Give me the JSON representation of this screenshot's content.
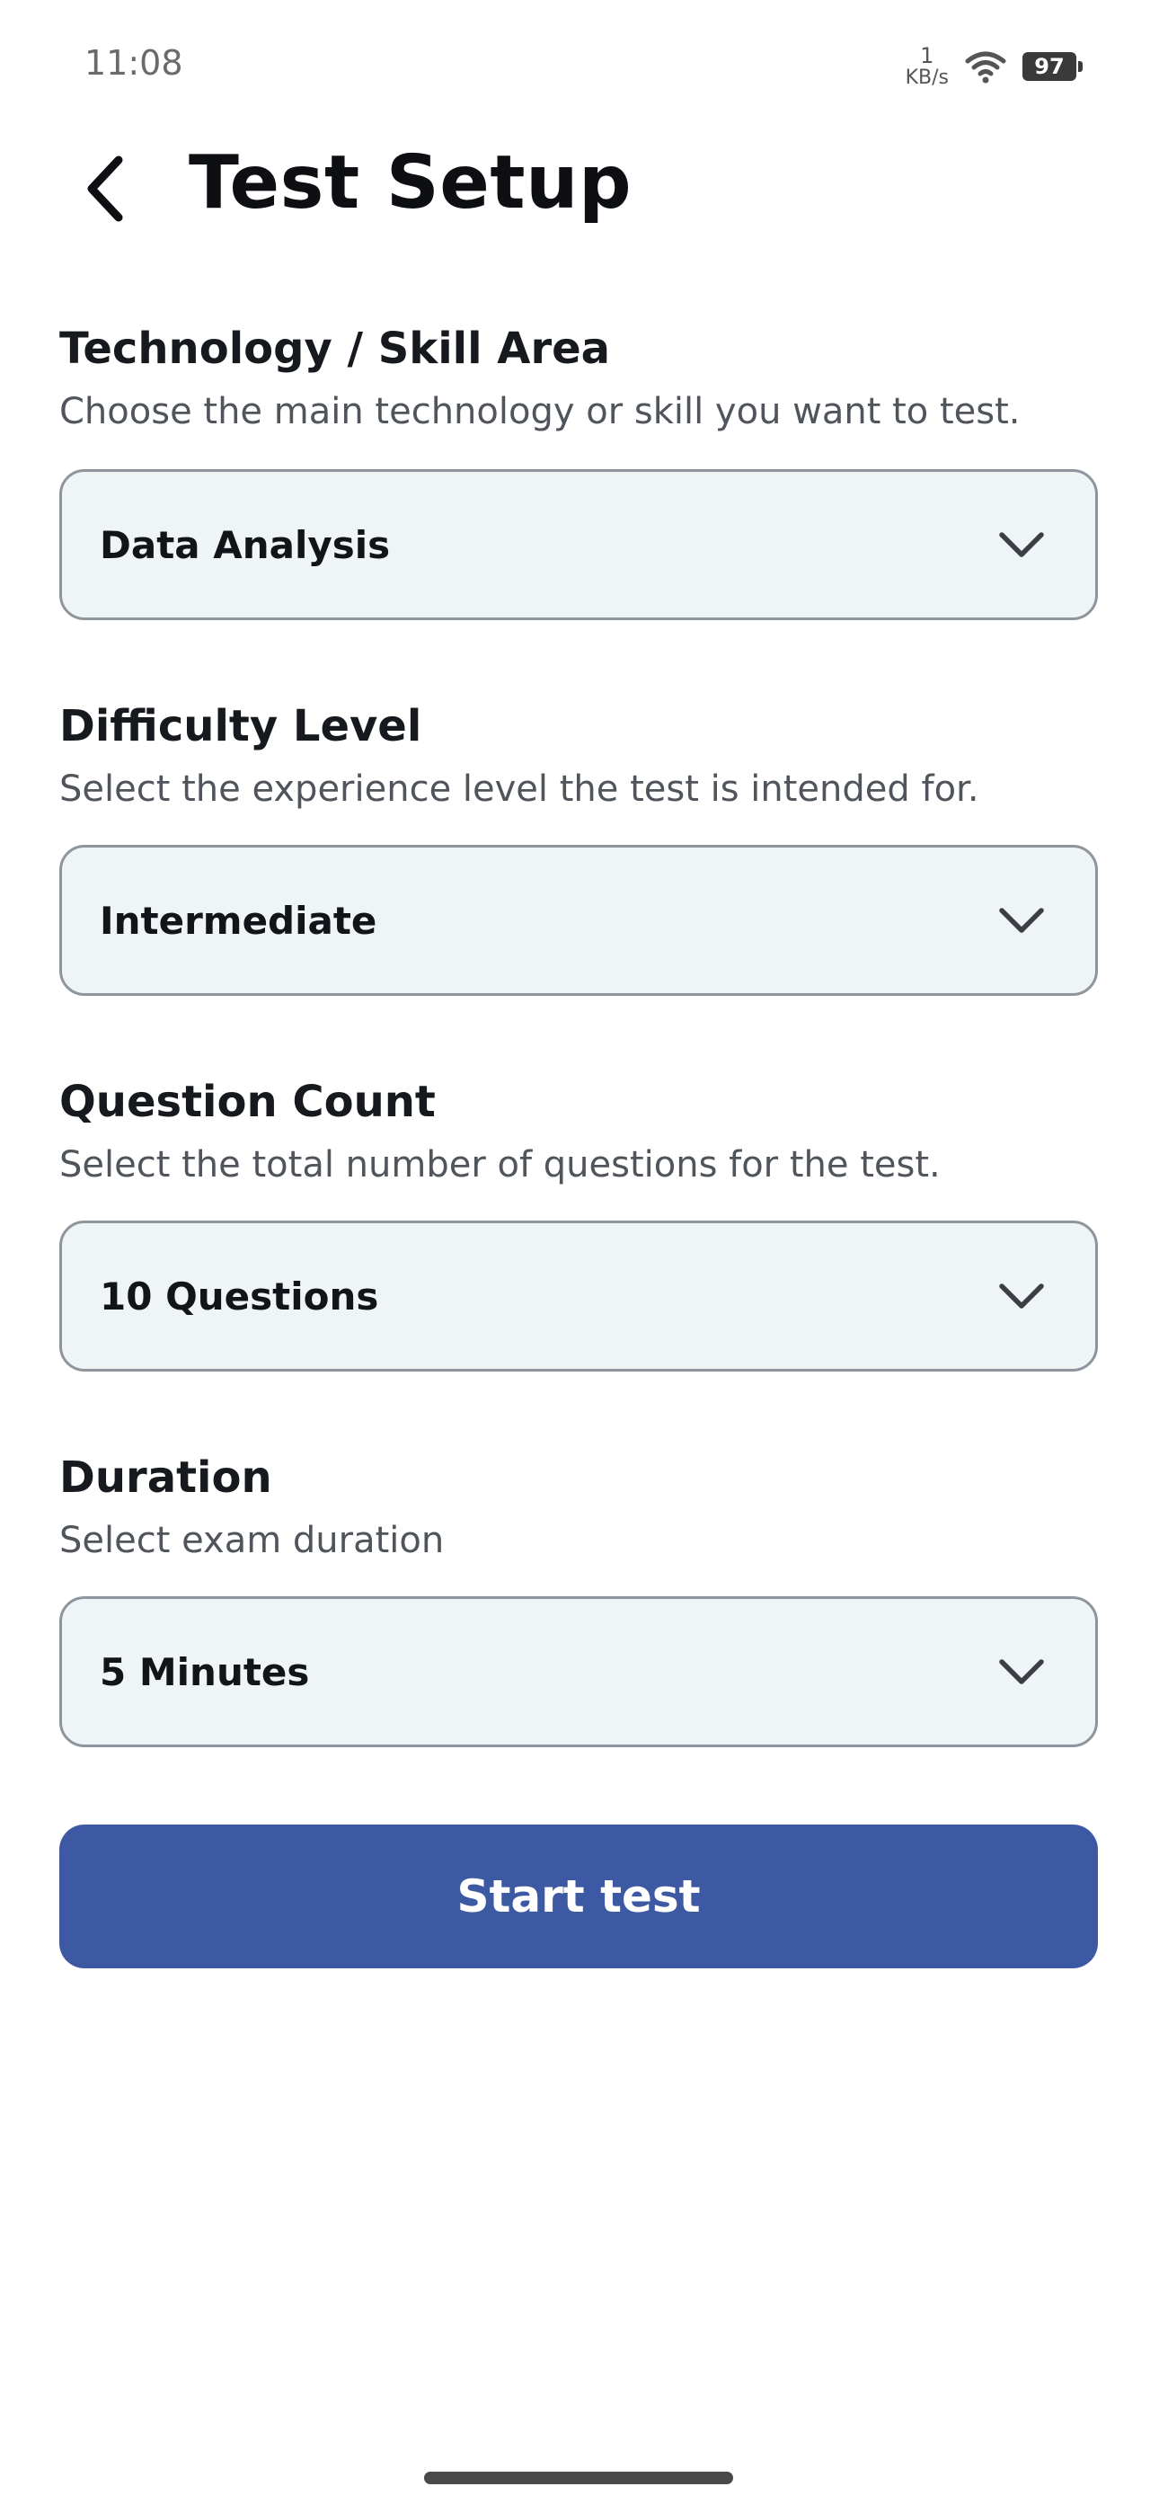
{
  "status_bar": {
    "time": "11:08",
    "net_speed_value": "1",
    "net_speed_unit": "KB/s",
    "wifi_icon": "wifi-icon",
    "battery_level": "97"
  },
  "header": {
    "back_icon": "chevron-left-icon",
    "title": "Test Setup"
  },
  "sections": [
    {
      "title": "Technology / Skill Area",
      "description": "Choose the main technology or skill you want to test.",
      "selected": "Data Analysis"
    },
    {
      "title": "Difficulty Level",
      "description": "Select the experience level the test is intended for.",
      "selected": "Intermediate"
    },
    {
      "title": "Question Count",
      "description": "Select the total number of questions for the test.",
      "selected": "10 Questions"
    },
    {
      "title": "Duration",
      "description": "Select exam duration",
      "selected": "5 Minutes"
    }
  ],
  "start_button": {
    "label": "Start test"
  },
  "colors": {
    "primary": "#3e59a3",
    "dropdown_bg": "#eff4f7",
    "dropdown_border": "#8f959c",
    "title_text": "#0d0f12",
    "desc_text": "#50555c"
  }
}
